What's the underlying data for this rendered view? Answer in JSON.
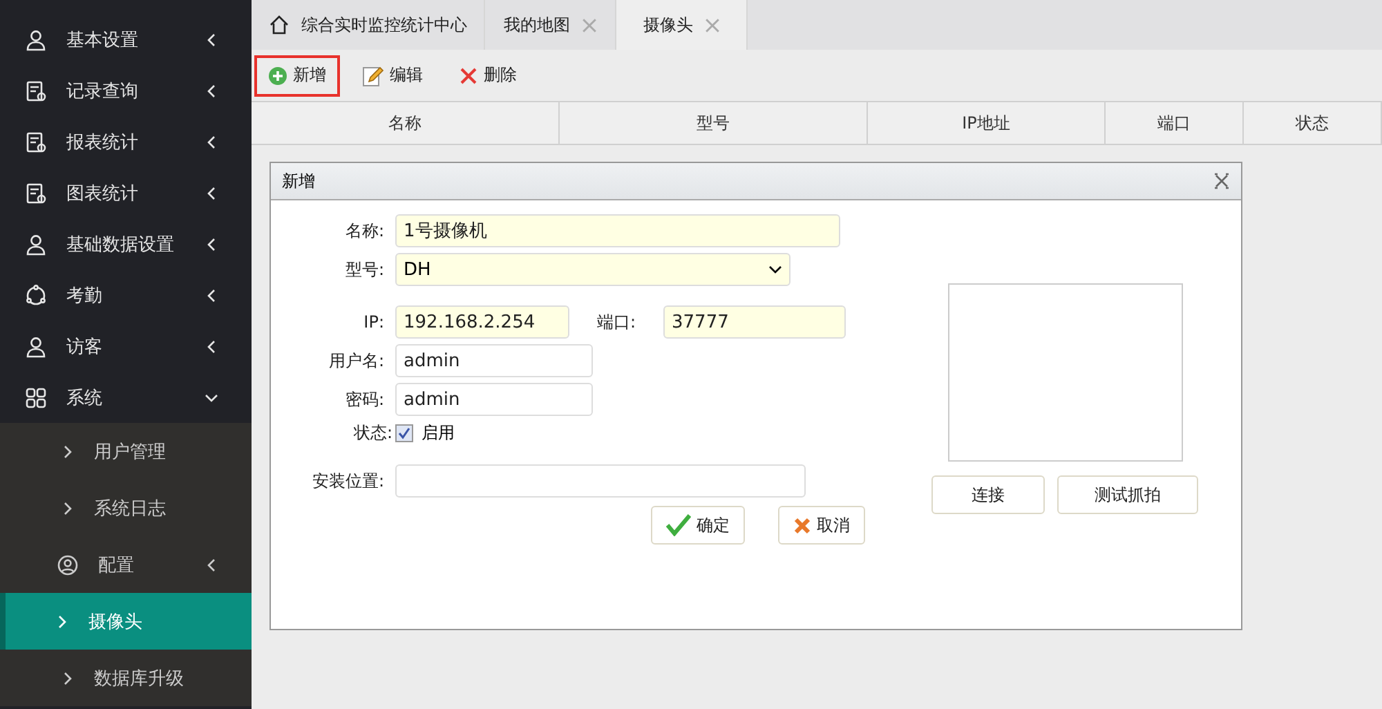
{
  "sidebar": {
    "items": [
      {
        "label": "基本设置",
        "kind": "user",
        "expanded": false
      },
      {
        "label": "记录查询",
        "kind": "doc",
        "expanded": false
      },
      {
        "label": "报表统计",
        "kind": "doc",
        "expanded": false
      },
      {
        "label": "图表统计",
        "kind": "doc",
        "expanded": false
      },
      {
        "label": "基础数据设置",
        "kind": "user",
        "expanded": false
      },
      {
        "label": "考勤",
        "kind": "cycle",
        "expanded": false
      },
      {
        "label": "访客",
        "kind": "user",
        "expanded": false
      },
      {
        "label": "系统",
        "kind": "grid",
        "expanded": true,
        "children": [
          {
            "label": "用户管理",
            "kind": "leaf",
            "selected": false
          },
          {
            "label": "系统日志",
            "kind": "leaf",
            "selected": false
          },
          {
            "label": "配置",
            "kind": "group",
            "selected": false,
            "expanded": false
          },
          {
            "label": "摄像头",
            "kind": "leaf",
            "selected": true
          },
          {
            "label": "数据库升级",
            "kind": "leaf",
            "selected": false
          }
        ]
      }
    ]
  },
  "tabs": [
    {
      "label": "综合实时监控统计中心",
      "kind": "home",
      "selected": false
    },
    {
      "label": "我的地图",
      "kind": "closable",
      "selected": false
    },
    {
      "label": "摄像头",
      "kind": "closable",
      "selected": true
    }
  ],
  "toolbar": [
    {
      "label": "新增",
      "kind": "add",
      "focused": true
    },
    {
      "label": "编辑",
      "kind": "edit",
      "focused": false
    },
    {
      "label": "删除",
      "kind": "delete",
      "focused": false
    }
  ],
  "table": {
    "columns": [
      "名称",
      "型号",
      "IP地址",
      "端口",
      "状态"
    ]
  },
  "dialog": {
    "title": "新增",
    "name": {
      "label": "名称:",
      "value": "1号摄像机",
      "highlighted": true
    },
    "model": {
      "label": "型号:",
      "value": "DH",
      "highlighted": true
    },
    "ip": {
      "label": "IP:",
      "value": "192.168.2.254",
      "highlighted": true
    },
    "port": {
      "label": "端口:",
      "value": "37777",
      "highlighted": true
    },
    "username": {
      "label": "用户名:",
      "value": "admin",
      "highlighted": false
    },
    "password": {
      "label": "密码:",
      "value": "admin",
      "highlighted": false
    },
    "status": {
      "label": "状态:",
      "option": "启用",
      "checked": true
    },
    "location": {
      "label": "安装位置:",
      "highlighted": false
    },
    "ok": "确定",
    "cancel": "取消",
    "connect": "连接",
    "snapshot": "测试抓拍"
  }
}
